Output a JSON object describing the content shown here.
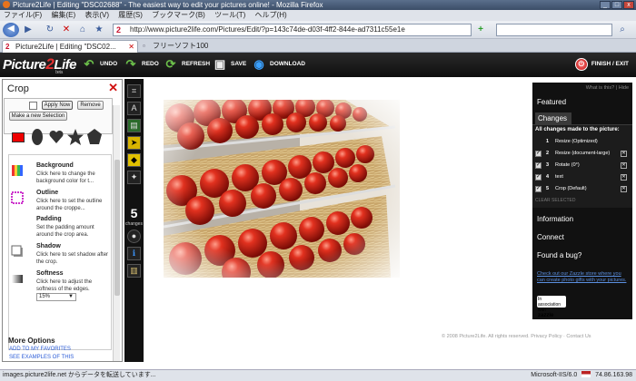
{
  "browser": {
    "window_title": "Picture2Life | Editing \"DSC02688\" - The easiest way to edit your pictures online! - Mozilla Firefox",
    "menu": [
      "ファイル(F)",
      "編集(E)",
      "表示(V)",
      "履歴(S)",
      "ブックマーク(B)",
      "ツール(T)",
      "ヘルプ(H)"
    ],
    "url": "http://www.picture2life.com/Pictures/Edit/?p=143c74de-d03f-4ff2-844e-ad7311c55e1e",
    "tabs": [
      {
        "label": "Picture2Life | Editing \"DSC02..."
      },
      {
        "label": "フリーソフト100"
      }
    ],
    "status_left": "images.picture2life.net からデータを転送しています...",
    "status_server": "Microsoft-IIS/6.0",
    "status_ip": "74.86.163.98"
  },
  "app_toolbar": {
    "logo_a": "Picture",
    "logo_b": "2",
    "logo_c": "Life",
    "logo_beta": "beta",
    "undo": "UNDO",
    "redo": "REDO",
    "refresh": "REFRESH",
    "save": "SAVE",
    "download": "DOWNLOAD",
    "finish": "FINISH / EXIT"
  },
  "crop_panel": {
    "title": "Crop",
    "close": "✕",
    "apply": "Apply Now",
    "remove": "Remove",
    "new_selection": "Make a new Selection",
    "effects": [
      {
        "title": "Background",
        "desc": "Click here to change the background color for t..."
      },
      {
        "title": "Outline",
        "desc": "Click here to set the outline around the croppe..."
      },
      {
        "title": "Padding",
        "desc": "Set the padding amount around the crop area."
      },
      {
        "title": "Shadow",
        "desc": "Click here to set shadow after the crop."
      },
      {
        "title": "Softness",
        "desc": "Click here to adjust the softness of the edges."
      }
    ],
    "softness_value": "15%",
    "more_options": "More Options",
    "add_favorites": "ADD TO MY FAVORITES",
    "see_examples": "SEE EXAMPLES OF THIS"
  },
  "tool_strip": {
    "changes_count": "5",
    "changes_label": "changes"
  },
  "right_panel": {
    "what_is_this": "What is this?",
    "hide": "Hide",
    "featured": "Featured",
    "changes_tab": "Changes",
    "all_changes": "All changes made to the picture:",
    "changes": [
      {
        "num": "1",
        "text": "Resize (Optimized)",
        "checked": false
      },
      {
        "num": "2",
        "text": "Resize (document-large)",
        "checked": true
      },
      {
        "num": "3",
        "text": "Rotate (0°)",
        "checked": true
      },
      {
        "num": "4",
        "text": "text",
        "checked": true
      },
      {
        "num": "5",
        "text": "Crop (Default)",
        "checked": true
      }
    ],
    "clear_selected": "CLEAR SELECTED",
    "information": "Information",
    "connect": "Connect",
    "bug": "Found a bug?",
    "zazzle_text": "Check out our Zazzle store where you can create photo gifts with your pictures.",
    "zazzle_badge_1": "In association with",
    "zazzle_badge_2": "zazzle"
  },
  "footer": {
    "copyright": "© 2008 Picture2Life. All rights reserved. Privacy Policy · Contact Us"
  },
  "colors": {
    "brand_red": "#e53030",
    "toolbar_dark": "#111111",
    "link_blue": "#2a5bd7"
  }
}
